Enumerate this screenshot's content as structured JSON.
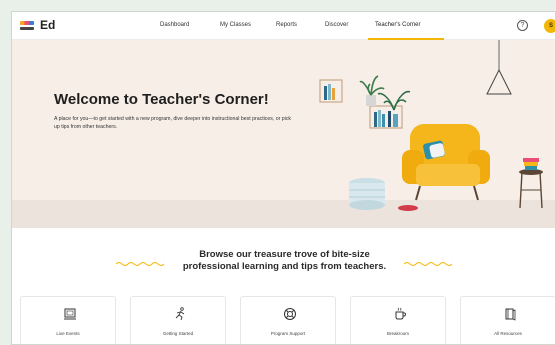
{
  "app": {
    "name": "Ed"
  },
  "nav": {
    "items": [
      {
        "label": "Dashboard"
      },
      {
        "label": "My Classes"
      },
      {
        "label": "Reports"
      },
      {
        "label": "Discover"
      },
      {
        "label": "Teacher's Corner"
      }
    ],
    "active": "Teacher's Corner",
    "help_label": "?",
    "avatar_initial": "S"
  },
  "hero": {
    "title": "Welcome to Teacher's Corner!",
    "subtitle": "A place for you—to get started with a new program, dive deeper into instructional best practices, or pick up tips from other teachers."
  },
  "browse": {
    "line1": "Browse our treasure trove of bite-size",
    "line2": "professional learning and tips from teachers."
  },
  "resources": [
    {
      "label": "Live Events",
      "icon": "monitor-icon"
    },
    {
      "label": "Getting Started",
      "icon": "running-person-icon"
    },
    {
      "label": "Program Support",
      "icon": "lifebuoy-icon"
    },
    {
      "label": "Breakroom",
      "icon": "coffee-cup-icon"
    },
    {
      "label": "All Resources",
      "icon": "book-icon"
    }
  ],
  "colors": {
    "accent": "#f2b705",
    "hero_bg": "#f6eee7",
    "chair": "#f4b61a"
  }
}
